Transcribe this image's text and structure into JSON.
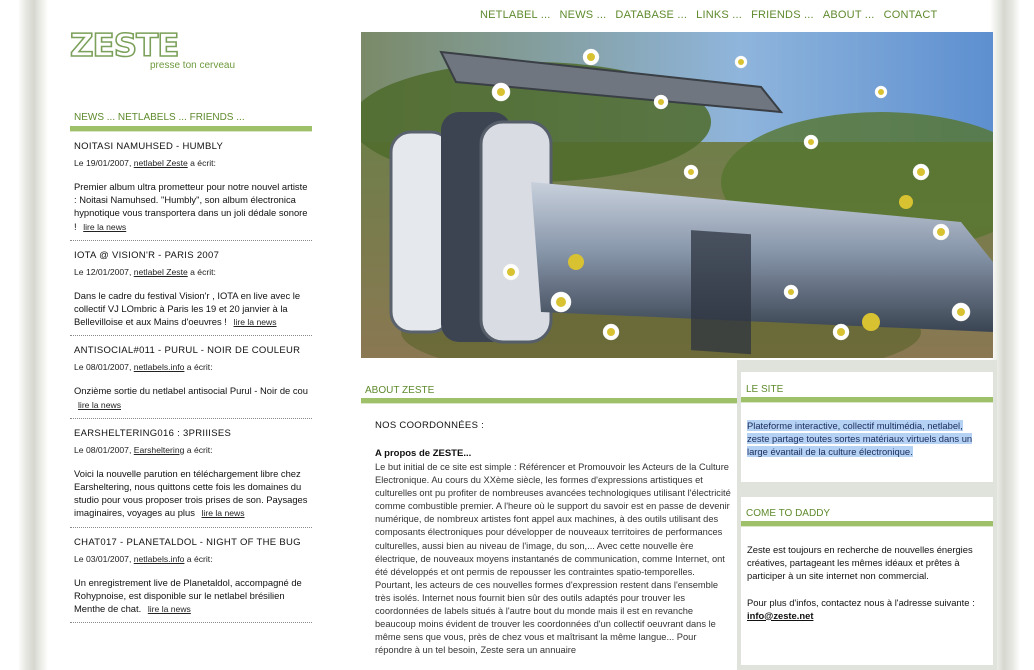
{
  "nav": {
    "items": [
      {
        "label": "NETLABEL ..."
      },
      {
        "label": "NEWS ..."
      },
      {
        "label": "DATABASE ..."
      },
      {
        "label": "LINKS ..."
      },
      {
        "label": "FRIENDS ..."
      },
      {
        "label": "ABOUT ..."
      },
      {
        "label": "CONTACT"
      }
    ]
  },
  "logo": {
    "word": "ZESTE",
    "tagline": "presse ton cerveau"
  },
  "left": {
    "heading": "NEWS ... NETLABELS ... FRIENDS ...",
    "news": [
      {
        "title": "NOITASI NAMUHSED - HUMBLY",
        "meta_prefix": "Le 19/01/2007,",
        "meta_link": "netlabel Zeste",
        "meta_suffix": "a écrit:",
        "body": "Premier album ultra prometteur pour notre nouvel artiste : Noitasi Namuhsed. \"Humbly\", son album électronica hypnotique vous transportera dans un joli dédale sonore !",
        "more": "lire la news"
      },
      {
        "title": "IOTA @ VISION'R - PARIS 2007",
        "meta_prefix": "Le 12/01/2007,",
        "meta_link": "netlabel Zeste",
        "meta_suffix": "a écrit:",
        "body": "Dans le cadre du festival Vision'r , IOTA en live avec le collectif VJ LOmbric à Paris les 19 et 20 janvier à la Bellevilloise et aux Mains d'oeuvres !",
        "more": "lire la news"
      },
      {
        "title": "ANTISOCIAL#011 - PURUL - NOIR DE COULEUR",
        "meta_prefix": "Le 08/01/2007,",
        "meta_link": "netlabels.info",
        "meta_suffix": "a écrit:",
        "body": "Onzième sortie du netlabel antisocial Purul - Noir de cou",
        "more": "lire la news"
      },
      {
        "title": "EARSHELTERING016 : 3PRIIISES",
        "meta_prefix": "Le 08/01/2007,",
        "meta_link": "Earsheltering",
        "meta_suffix": "a écrit:",
        "body": "Voici la nouvelle parution en téléchargement libre chez Earsheltering, nous quittons cette fois les domaines du studio pour vous proposer trois prises de son. Paysages imaginaires, voyages au plus",
        "more": "lire la news"
      },
      {
        "title": "CHAT017 - PLANETALDOL - NIGHT OF THE BUG",
        "meta_prefix": "Le 03/01/2007,",
        "meta_link": "netlabels.info",
        "meta_suffix": "a écrit:",
        "body": "Un enregistrement live de Planetaldol, accompagné de Rohypnoise, est disponible sur le netlabel brésilien Menthe de chat.",
        "more": "lire la news"
      }
    ]
  },
  "about": {
    "heading": "ABOUT ZESTE",
    "coord": "NOS COORDONNÉES :",
    "subtitle": "A propos de ZESTE...",
    "text": "Le but initial de ce site est simple : Référencer et Promouvoir les Acteurs de la Culture Electronique. Au cours du XXème siècle, les formes d'expressions artistiques et culturelles ont pu profiter de nombreuses avancées technologiques utilisant l'électricité comme combustible premier. A l'heure où le support du savoir est en passe de devenir numérique, de nombreux artistes font appel aux machines, à des outils utilisant des composants électroniques pour développer de nouveaux territoires de performances culturelles, aussi bien au niveau de l'image, du son,... Avec cette nouvelle ère électrique, de nouveaux moyens instantanés de communication, comme Internet, ont été développés et ont permis de repousser les contraintes spatio-temporelles. Pourtant, les acteurs de ces nouvelles formes d'expression restent dans l'ensemble très isolés. Internet nous fournit bien sûr des outils adaptés pour trouver les coordonnées de labels situés à l'autre bout du monde mais il est en revanche beaucoup moins évident de trouver les coordonnées d'un collectif oeuvrant dans le même sens que vous, près de chez vous et maîtrisant la même langue... Pour répondre à un tel besoin, Zeste sera un annuaire"
  },
  "site": {
    "heading": "LE  SITE",
    "text": "Plateforme interactive, collectif multimédia, netlabel, zeste partage toutes sortes matériaux virtuels dans un large évantail de la culture électronique."
  },
  "daddy": {
    "heading": "COME TO DADDY",
    "text1": "Zeste est toujours en recherche de nouvelles énergies créatives, partageant les mêmes idéaux et prêtes à participer à un site internet non commercial.",
    "text2_prefix": "Pour plus d'infos, contactez nous à l'adresse suivante :",
    "email": "info@zeste.net"
  },
  "colors": {
    "accent_green": "#5e8a2c",
    "bar_green": "#9dc068",
    "highlight": "#b5d2f5"
  }
}
